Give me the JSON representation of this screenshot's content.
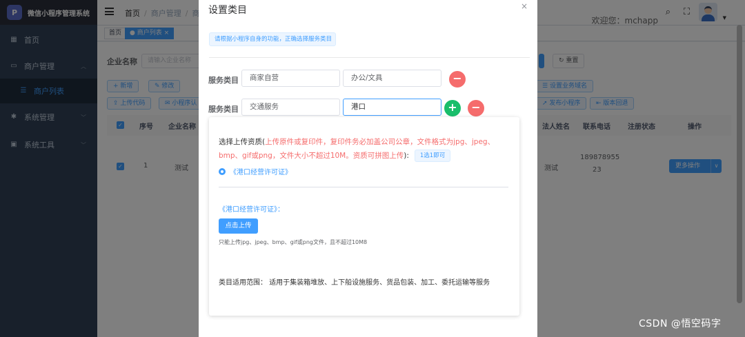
{
  "app": {
    "logo_text": "P",
    "title": "微信小程序管理系统"
  },
  "sidebar": {
    "items": [
      {
        "label": "首页",
        "icon": "dashboard-icon"
      },
      {
        "label": "商户管理",
        "icon": "monitor-icon"
      },
      {
        "label": "商户列表",
        "icon": "list-icon"
      },
      {
        "label": "系统管理",
        "icon": "gear-icon"
      },
      {
        "label": "系统工具",
        "icon": "toolbox-icon"
      }
    ]
  },
  "navbar": {
    "breadcrumb": [
      "首页",
      "商户管理",
      "商"
    ],
    "welcome": "欢迎您：mchapp"
  },
  "tags": [
    "首页",
    "商户列表"
  ],
  "background": {
    "filter_label": "企业名称",
    "filter_placeholder": "请输入企业名称",
    "reset_label": "重置",
    "buttons_row1": [
      "新增",
      "修改"
    ],
    "buttons_row2": [
      "上传代码",
      "小程序认"
    ],
    "right_buttons_row1": [
      "设置业务域名"
    ],
    "right_buttons_row2": [
      "发布小程序",
      "版本回退"
    ],
    "columns": [
      "序号",
      "企业名称",
      "法人姓名",
      "联系电话",
      "注册状态",
      "操作"
    ],
    "row": {
      "index": "1",
      "company": "测试",
      "legal_person": "测试",
      "phone_line1": "189878955",
      "phone_line2": "23",
      "action": "更多操作"
    }
  },
  "dialog": {
    "title": "设置类目",
    "close_symbol": "×",
    "tip": "请根据小程序自身的功能，正确选择服务类目",
    "rows": [
      {
        "label": "服务类目",
        "first": "商家自营",
        "second": "办公/文具"
      },
      {
        "label": "服务类目",
        "first": "交通服务",
        "second": "港口"
      }
    ],
    "upload": {
      "prefix": "选择上传资质(",
      "requirement": "上传原件或复印件，复印件务必加盖公司公章，文件格式为jpg、jpeg、bmp、gif或png，文件大小不超过10M。资质可拼图上传",
      "suffix": "):",
      "pill": "1选1即可",
      "option": "《港口经营许可证》",
      "license_title": "《港口经营许可证》：",
      "button": "点击上传",
      "hint": "只能上传jpg、jpeg、bmp、gif或png文件，且不超过10M8"
    },
    "scope_label": "类目适用范围：",
    "scope_text": "适用于集装箱堆放、上下船设施服务、货品包装、加工、委托运输等服务"
  },
  "watermark": "CSDN @悟空码字",
  "colors": {
    "primary": "#409eff",
    "danger": "#f56c6c",
    "success": "#19be6b",
    "sidebar": "#304156"
  }
}
